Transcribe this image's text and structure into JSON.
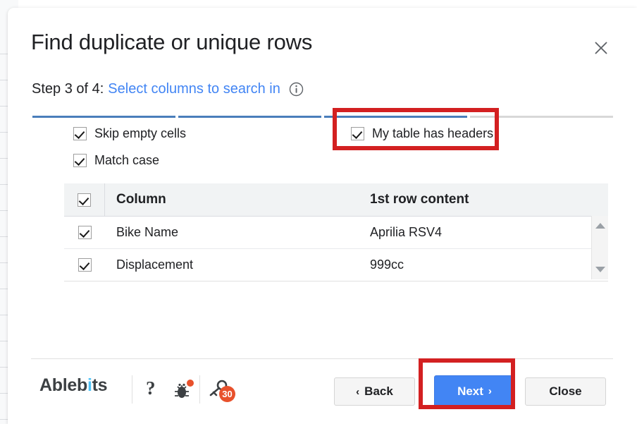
{
  "dialog": {
    "title": "Find duplicate or unique rows",
    "close_icon": "close-icon"
  },
  "step": {
    "prefix": "Step 3 of 4:",
    "link": "Select columns to search in",
    "info_icon": "info-icon",
    "current": 3,
    "total": 4,
    "segments": [
      true,
      true,
      true,
      false
    ]
  },
  "options": [
    {
      "label": "Skip empty cells",
      "checked": true
    },
    {
      "label": "Match case",
      "checked": true
    },
    {
      "label": "My table has headers",
      "checked": true
    }
  ],
  "table": {
    "header_checkbox_checked": true,
    "columns": [
      "Column",
      "1st row content"
    ],
    "rows": [
      {
        "checked": true,
        "column": "Bike Name",
        "content": "Aprilia RSV4"
      },
      {
        "checked": true,
        "column": "Displacement",
        "content": "999cc"
      }
    ],
    "scrollbar": {
      "up_icon": "scroll-up-arrow-icon",
      "down_icon": "scroll-down-arrow-icon"
    }
  },
  "footer": {
    "brand_head": "Ableb",
    "brand_dot": "i",
    "brand_tail": "ts",
    "help_label": "?",
    "bug_icon": "bug-report-icon",
    "license_icon": "license-key-icon",
    "license_badge": "30",
    "buttons": {
      "back": "Back",
      "next": "Next",
      "close": "Close",
      "back_chevron": "‹",
      "next_chevron": "›"
    }
  },
  "colors": {
    "accent_blue": "#4285f4",
    "progress_blue": "#4a7ebb",
    "annotation_red": "#d32021",
    "badge_orange": "#e8512c",
    "header_grey": "#f1f3f4"
  }
}
